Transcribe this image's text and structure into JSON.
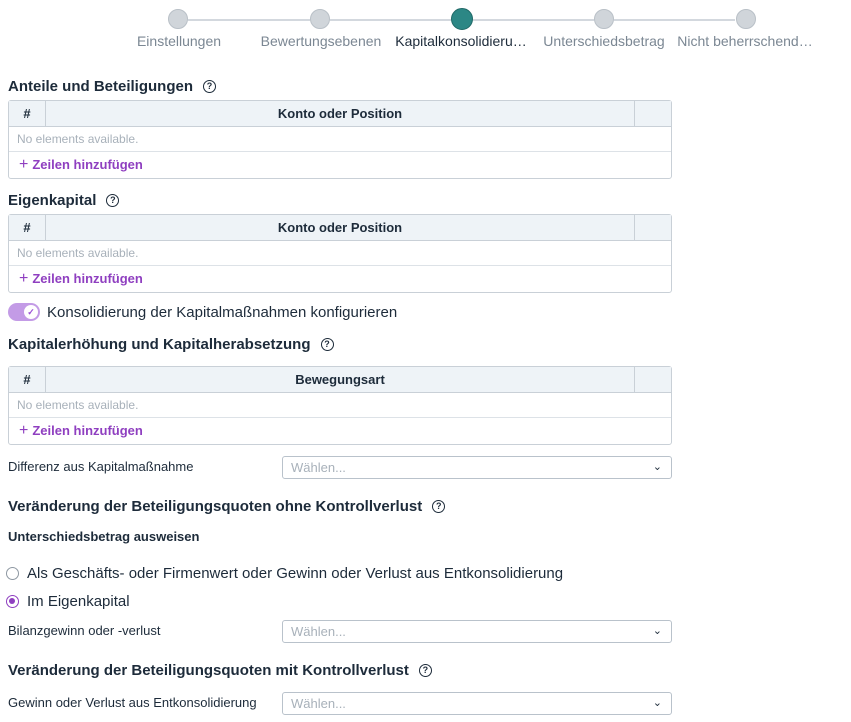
{
  "stepper": {
    "steps": [
      {
        "label": "Einstellungen",
        "active": false
      },
      {
        "label": "Bewertungsebenen",
        "active": false
      },
      {
        "label": "Kapitalkonsolidieru…",
        "active": true
      },
      {
        "label": "Unterschiedsbetrag",
        "active": false
      },
      {
        "label": "Nicht beherrschend…",
        "active": false
      }
    ]
  },
  "help_glyph": "?",
  "anteile": {
    "title": "Anteile und Beteiligungen",
    "col_num": "#",
    "col_main": "Konto oder Position",
    "empty": "No elements available.",
    "add": "Zeilen hinzufügen"
  },
  "eigenkapital": {
    "title": "Eigenkapital",
    "col_num": "#",
    "col_main": "Konto oder Position",
    "empty": "No elements available.",
    "add": "Zeilen hinzufügen"
  },
  "toggle": {
    "label": "Konsolidierung der Kapitalmaßnahmen konfigurieren",
    "checked": true,
    "check_glyph": "✓"
  },
  "kapitalerhoehung": {
    "title": "Kapitalerhöhung und Kapitalherabsetzung",
    "col_num": "#",
    "col_main": "Bewegungsart",
    "empty": "No elements available.",
    "add": "Zeilen hinzufügen"
  },
  "differenz": {
    "label": "Differenz aus Kapitalmaßnahme",
    "placeholder": "Wählen..."
  },
  "ohne_kontrollverlust": {
    "title": "Veränderung der Beteiligungsquoten ohne Kontrollverlust",
    "subtitle": "Unterschiedsbetrag ausweisen",
    "options": [
      {
        "label": "Als Geschäfts- oder Firmenwert oder Gewinn oder Verlust aus Entkonsolidierung",
        "checked": false
      },
      {
        "label": "Im Eigenkapital",
        "checked": true
      }
    ],
    "bilanz_label": "Bilanzgewinn oder -verlust",
    "bilanz_placeholder": "Wählen..."
  },
  "mit_kontrollverlust": {
    "title": "Veränderung der Beteiligungsquoten mit Kontrollverlust",
    "gv_label": "Gewinn oder Verlust aus Entkonsolidierung",
    "gv_placeholder": "Wählen..."
  },
  "colors": {
    "accent": "#8f3fc0",
    "step_active": "#2c8785",
    "toggle_track": "#c39be6"
  },
  "icons": {
    "chevron": "chevron-down-icon",
    "plus": "plus-icon",
    "help": "help-circle-icon"
  }
}
